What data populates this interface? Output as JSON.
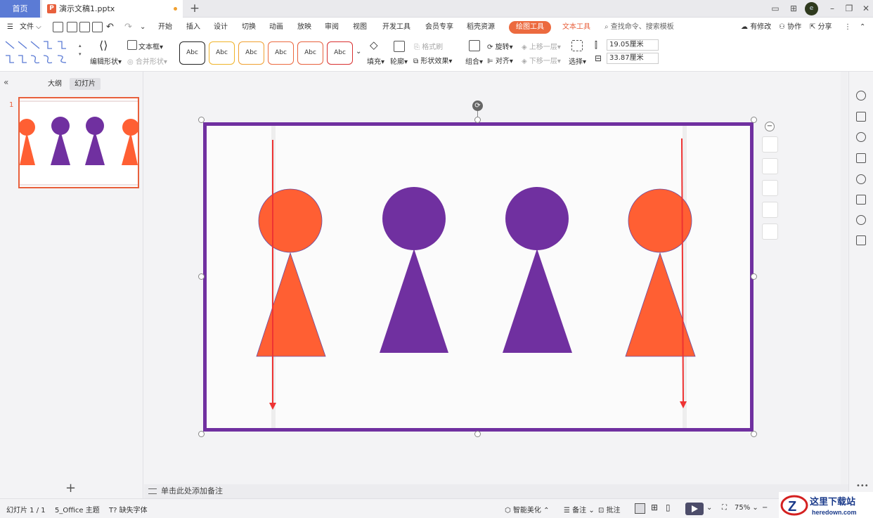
{
  "titlebar": {
    "home_tab": "首页",
    "doc_tab": "演示文稿1.pptx",
    "doc_icon": "P",
    "add_tab": "+",
    "avatar": "e"
  },
  "menu": {
    "file": "文件",
    "items": [
      "开始",
      "插入",
      "设计",
      "切换",
      "动画",
      "放映",
      "审阅",
      "视图",
      "开发工具",
      "会员专享",
      "稻壳资源"
    ],
    "drawing_tool": "绘图工具",
    "text_tool": "文本工具",
    "search_placeholder": "查找命令、搜索模板",
    "modified": "有修改",
    "collab": "协作",
    "share": "分享"
  },
  "ribbon": {
    "edit_shape": "编辑形状",
    "textbox": "文本框",
    "merge_shape": "合并形状",
    "style_samples": [
      "Abc",
      "Abc",
      "Abc",
      "Abc",
      "Abc",
      "Abc"
    ],
    "style_colors": [
      "#222222",
      "#f0b429",
      "#f0a030",
      "#ec6a3f",
      "#e8603c",
      "#d93030"
    ],
    "fill": "填充",
    "outline": "轮廓",
    "format_painter": "格式刷",
    "shape_effect": "形状效果",
    "group": "组合",
    "rotate": "旋转",
    "align": "对齐",
    "bring_forward": "上移一层",
    "send_backward": "下移一层",
    "select": "选择",
    "height": "19.05厘米",
    "width": "33.87厘米"
  },
  "leftpane": {
    "outline_tab": "大纲",
    "slides_tab": "幻灯片",
    "slide_number": "1",
    "add_slide": "+"
  },
  "slide": {
    "figures": [
      {
        "color": "#ff5f33",
        "has_arrow": true
      },
      {
        "color": "#7030a0",
        "has_arrow": false
      },
      {
        "color": "#7030a0",
        "has_arrow": false
      },
      {
        "color": "#ff5f33",
        "has_arrow": true
      }
    ],
    "arrow_color": "#ee3333",
    "border_color": "#7030a0"
  },
  "notes": {
    "placeholder": "单击此处添加备注"
  },
  "statusbar": {
    "slide_count": "幻灯片 1 / 1",
    "theme": "5_Office 主题",
    "missing_font": "缺失字体",
    "smart_beautify": "智能美化",
    "notes": "备注",
    "comment": "批注",
    "zoom": "75%"
  },
  "watermark": {
    "title": "这里下载站",
    "url": "heredown.com"
  }
}
